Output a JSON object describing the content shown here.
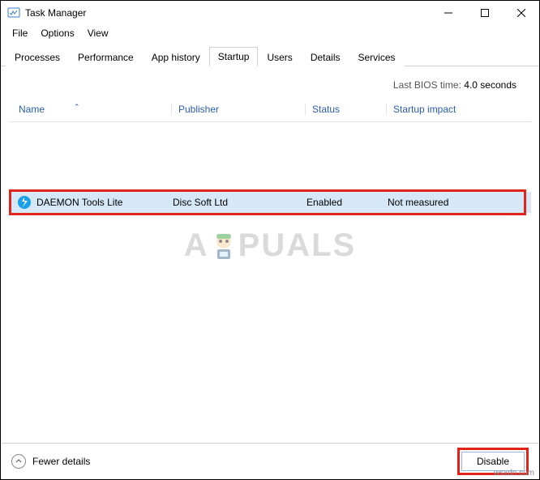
{
  "window": {
    "title": "Task Manager"
  },
  "menus": {
    "file": "File",
    "options": "Options",
    "view": "View"
  },
  "tabs": {
    "processes": "Processes",
    "performance": "Performance",
    "apphistory": "App history",
    "startup": "Startup",
    "users": "Users",
    "details": "Details",
    "services": "Services",
    "active": "startup"
  },
  "bios": {
    "label": "Last BIOS time:",
    "value": "4.0 seconds"
  },
  "columns": {
    "name": "Name",
    "publisher": "Publisher",
    "status": "Status",
    "impact": "Startup impact"
  },
  "row": {
    "icon": "daemon-tools-icon",
    "name": "DAEMON Tools Lite",
    "publisher": "Disc Soft Ltd",
    "status": "Enabled",
    "impact": "Not measured"
  },
  "bottom": {
    "fewer": "Fewer details",
    "disable": "Disable"
  },
  "watermark": {
    "left": "A",
    "right": "PUALS"
  },
  "source": "wsxdn.com"
}
